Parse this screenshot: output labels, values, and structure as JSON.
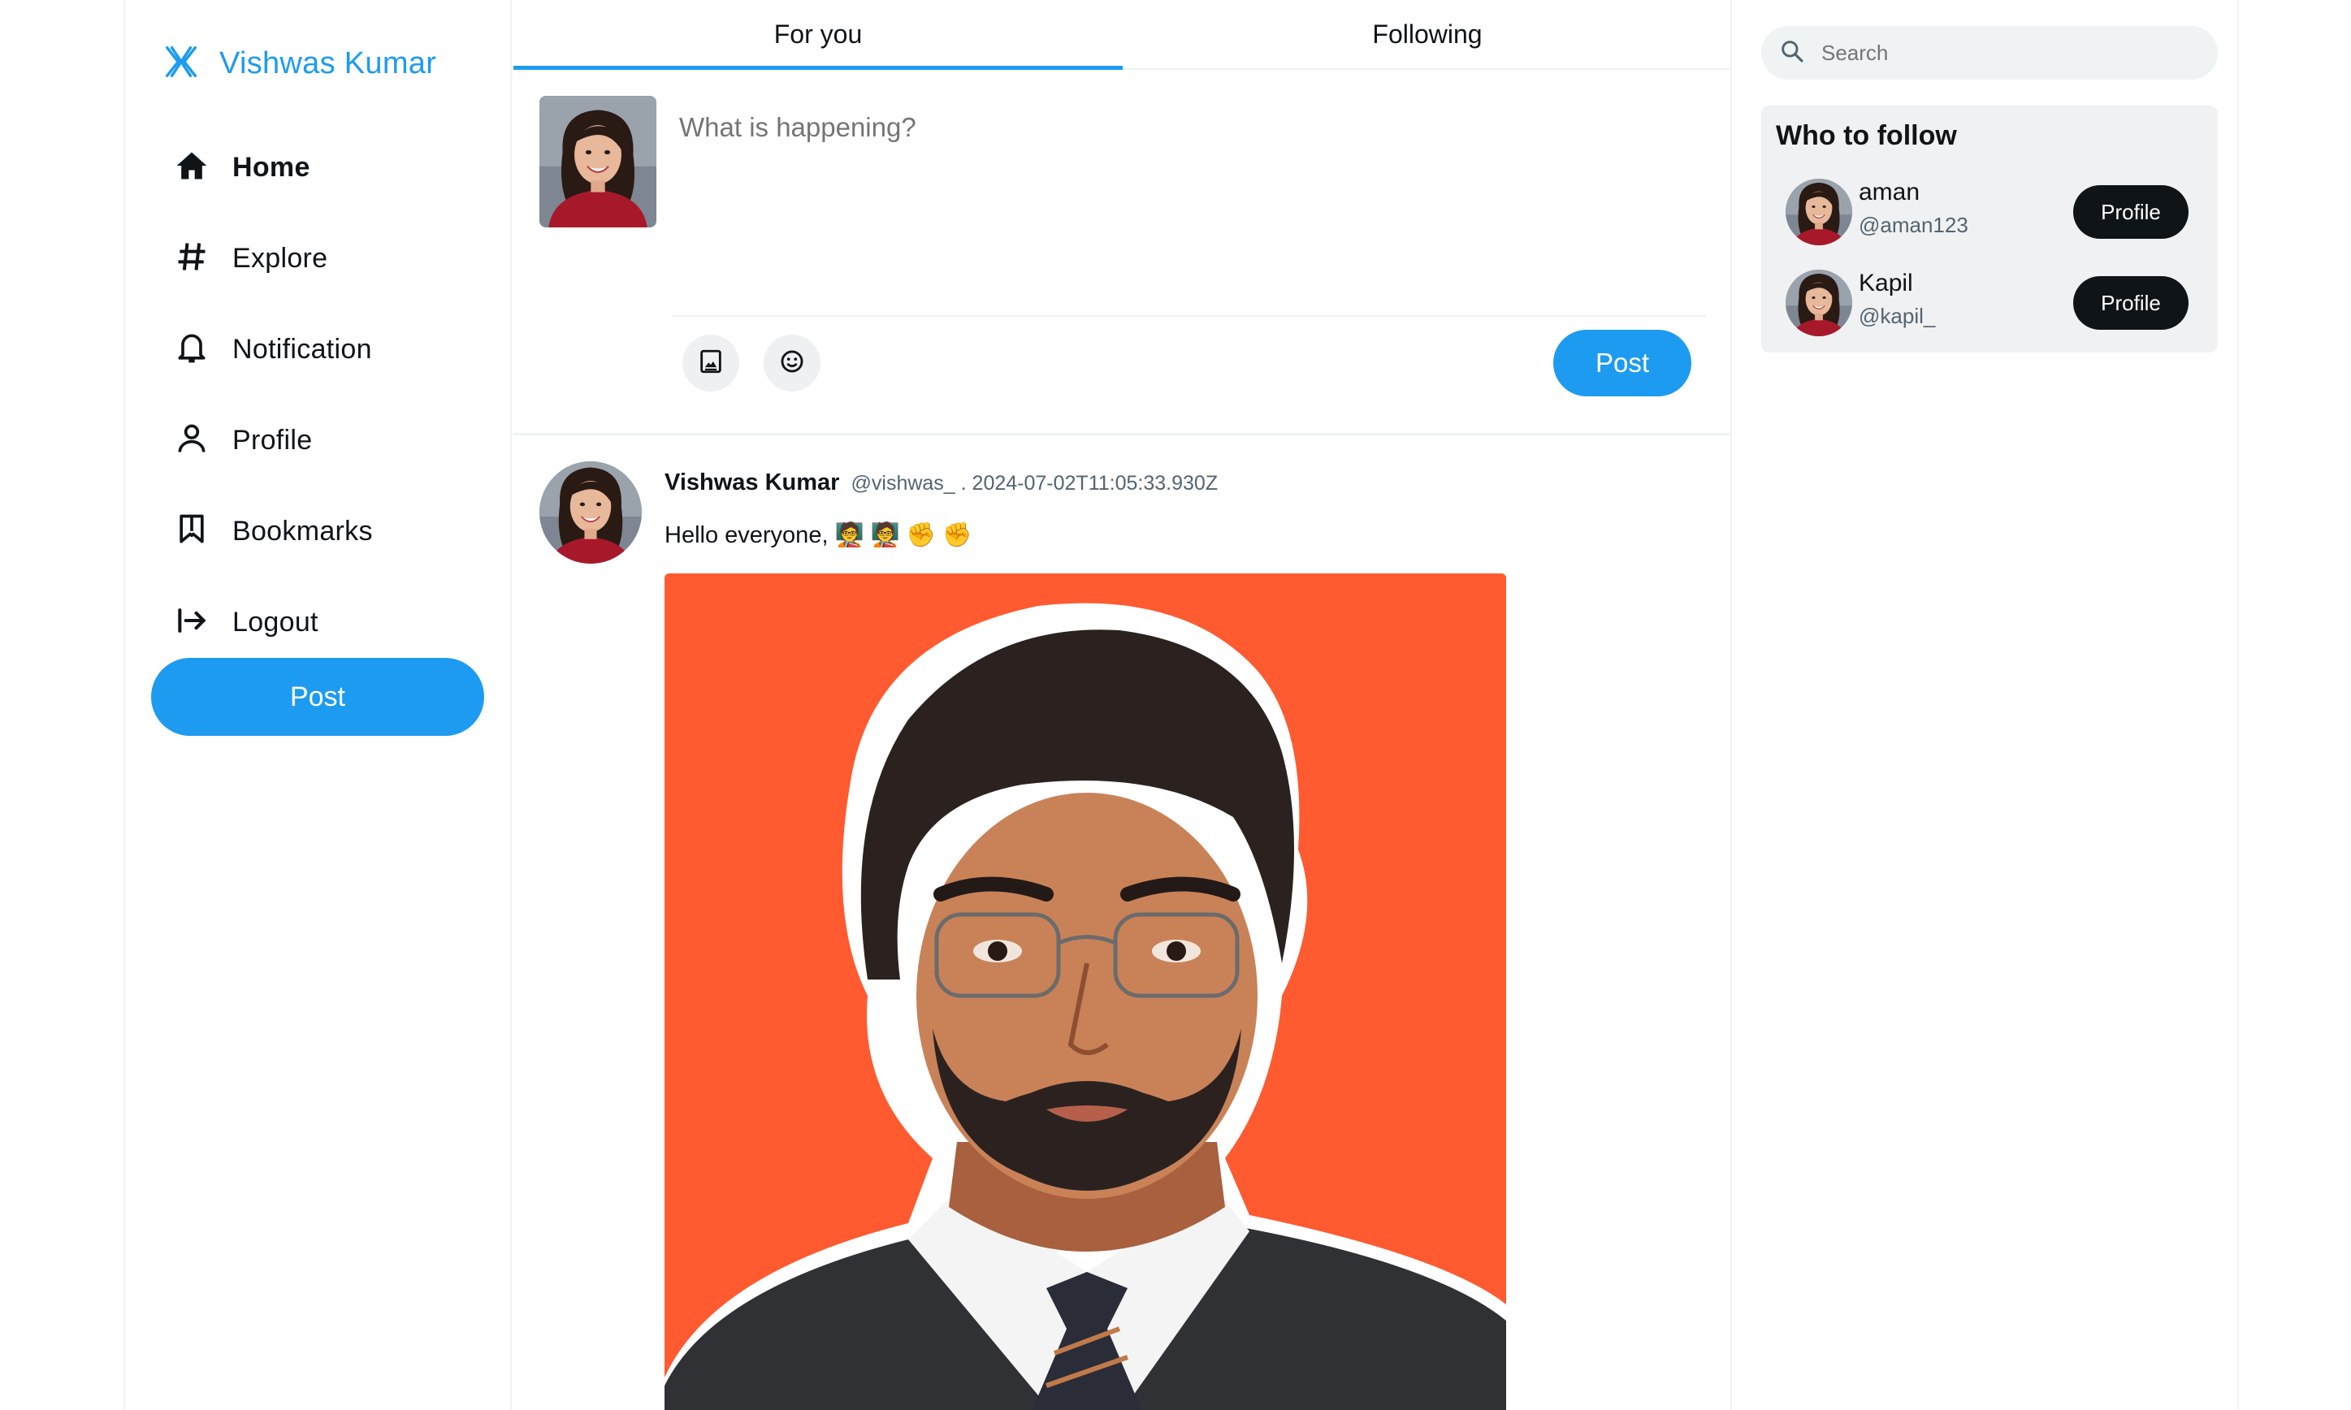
{
  "brand": {
    "name": "Vishwas Kumar",
    "icon": "x-logo-icon",
    "color": "#1d9bf0"
  },
  "nav": {
    "items": [
      {
        "label": "Home",
        "icon": "home-icon"
      },
      {
        "label": "Explore",
        "icon": "hashtag-icon"
      },
      {
        "label": "Notification",
        "icon": "bell-icon"
      },
      {
        "label": "Profile",
        "icon": "user-icon"
      },
      {
        "label": "Bookmarks",
        "icon": "bookmark-icon"
      },
      {
        "label": "Logout",
        "icon": "logout-icon"
      }
    ],
    "post_label": "Post"
  },
  "tabs": [
    {
      "label": "For you",
      "active": true
    },
    {
      "label": "Following",
      "active": false
    }
  ],
  "composer": {
    "placeholder": "What is happening?",
    "tools": [
      "image-icon",
      "emoji-icon"
    ],
    "post_label": "Post"
  },
  "tweet": {
    "name": "Vishwas Kumar",
    "handle": "@vishwas_ . 2024-07-02T11:05:33.930Z",
    "text": "Hello everyone, 🧑‍🏫 🧑‍🏫 ✊ ✊"
  },
  "search": {
    "placeholder": "Search"
  },
  "who_to_follow": {
    "title": "Who to follow",
    "users": [
      {
        "name": "aman",
        "handle": "@aman123",
        "button": "Profile"
      },
      {
        "name": "Kapil",
        "handle": "@kapil_",
        "button": "Profile"
      }
    ]
  },
  "colors": {
    "accent": "#1d9bf0",
    "dark_button": "#0f1419",
    "photo_bg": "#ff5a30"
  }
}
